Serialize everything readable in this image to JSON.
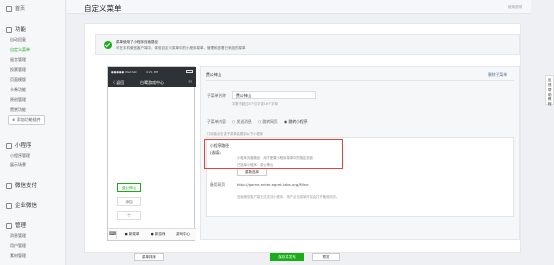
{
  "sidebar": {
    "home": "首页",
    "function_section": "功能",
    "function_items": [
      "自动回复",
      "自定义菜单",
      "留言管理",
      "投票管理",
      "页面模版",
      "卡券功能",
      "原创管理",
      "赞赏功能",
      "添加功能插件"
    ],
    "miniprogram_section": "小程序",
    "miniprogram_items": [
      "小程序管理",
      "展示场景"
    ],
    "wechat_pay": "微信支付",
    "enterprise_wechat": "企业微信",
    "manage_section": "管理",
    "manage_items": [
      "消息管理",
      "用户管理",
      "素材管理"
    ]
  },
  "header": {
    "title": "自定义菜单",
    "help": "使用说明"
  },
  "banner": {
    "line1": "菜单使用了小程序页面路径",
    "line2": "可在手机微信客户端中，体验自定义菜单中的小程序菜单，管理和查看已添加的菜单"
  },
  "phone": {
    "status": "●●●●● WeChat",
    "time": "4:21 PM",
    "back": "〈 返回",
    "title": "白鹭游戏中心",
    "submenu_item": "费公神山",
    "submenu_add": "添加",
    "plus": "+",
    "tabs": [
      "● 新菜单",
      "● 新游戏",
      "游戏中心"
    ]
  },
  "editor": {
    "menu_title": "费公神山",
    "delete_link": "删除子菜单",
    "name_label": "子菜单名称",
    "name_value": "费公神山",
    "name_hint": "字数不超过8个汉字或16个字母",
    "content_label": "子菜单内容",
    "content_options": [
      "发送消息",
      "跳转网页",
      "跳转小程序"
    ],
    "content_selected": "跳转小程序",
    "jump_desc": "订阅者点击该子菜单会跳到以下小程序",
    "mini_label": "小程序路径",
    "mini_sub": "(选填)",
    "mini_desc1": "小程序页面路径：用于配置小程序菜单中的指定页面",
    "mini_desc2": "已选择小程序：费公神山",
    "reselect": "重新选择",
    "backup_label": "备用网页",
    "backup_value": "http://game.enter.egret-labs.org/Mine",
    "backup_hint": "旧版微信客户端无法支持小程序，用户点击菜单时将会打开备用网页。"
  },
  "footer": {
    "sort": "菜单排序",
    "save": "保存并发布",
    "preview": "预览"
  },
  "tools": [
    "反馈",
    "帮助",
    "教程"
  ]
}
